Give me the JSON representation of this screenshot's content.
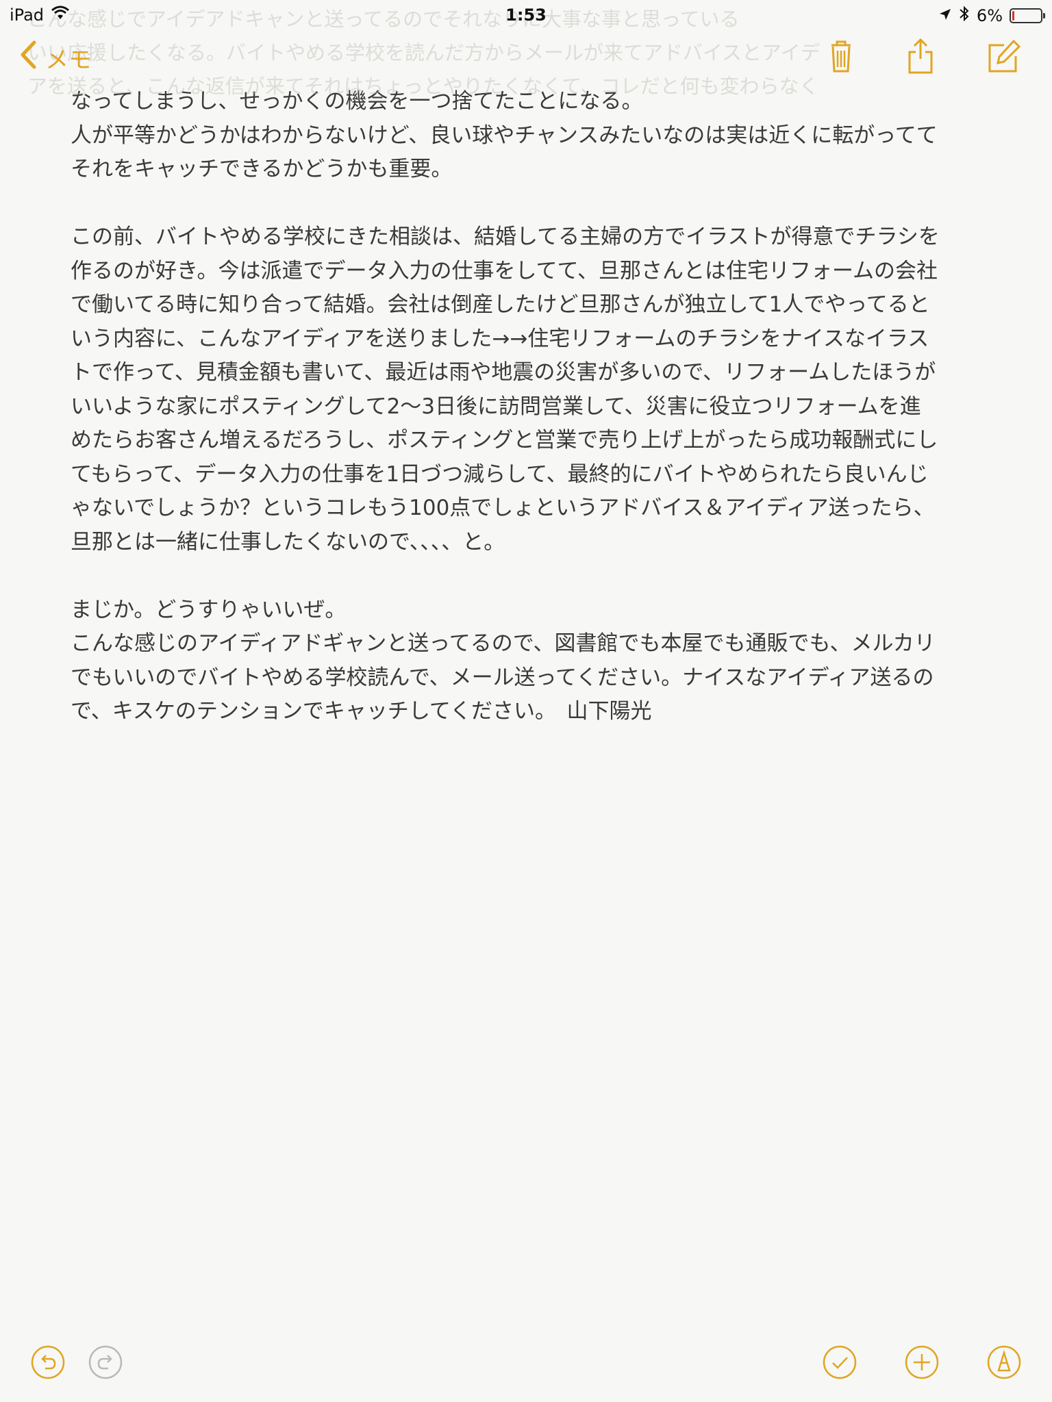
{
  "status_bar": {
    "device": "iPad",
    "time": "1:53",
    "battery_percent": "6%",
    "battery_level": 0.06
  },
  "ghost_lines": [
    "こんな感じでアイデアドキャンと送ってるのでそれなりに大事な事と思っている",
    "いい応援したくなる。バイトやめる学校を読んだ方からメールが来てアドバイスとアイデ",
    "アを送ると、こんな返信が来てそれはちょっとやりたくなくて、コレだと何も変わらなく"
  ],
  "nav": {
    "back_label": "メモ",
    "accent": "#e0a522"
  },
  "note": {
    "lines": [
      "なってしまうし、せっかくの機会を一つ捨てたことになる。",
      "人が平等かどうかはわからないけど、良い球やチャンスみたいなのは実は近くに転がってて",
      "それをキャッチできるかどうかも重要。",
      "",
      "この前、バイトやめる学校にきた相談は、結婚してる主婦の方でイラストが得意でチラシを",
      "作るのが好き。今は派遣でデータ入力の仕事をしてて、旦那さんとは住宅リフォームの会社",
      "で働いてる時に知り合って結婚。会社は倒産したけど旦那さんが独立して1人でやってると",
      "いう内容に、こんなアイディアを送りました→→住宅リフォームのチラシをナイスなイラス",
      "トで作って、見積金額も書いて、最近は雨や地震の災害が多いので、リフォームしたほうが",
      "いいような家にポスティングして2〜3日後に訪問営業して、災害に役立つリフォームを進",
      "めたらお客さん増えるだろうし、ポスティングと営業で売り上げ上がったら成功報酬式にし",
      "てもらって、データ入力の仕事を1日づつ減らして、最終的にバイトやめられたら良いんじ",
      "ゃないでしょうか？というコレもう100点でしょというアドバイス＆アイディア送ったら、",
      "旦那とは一緒に仕事したくないので、、、、と。",
      "",
      "まじか。どうすりゃいいぜ。",
      "こんな感じのアイディアドギャンと送ってるので、図書館でも本屋でも通販でも、メルカリ",
      "でもいいのでバイトやめる学校読んで、メール送ってください。ナイスなアイディア送るの",
      "で、キスケのテンションでキャッチしてください。　山下陽光"
    ]
  }
}
